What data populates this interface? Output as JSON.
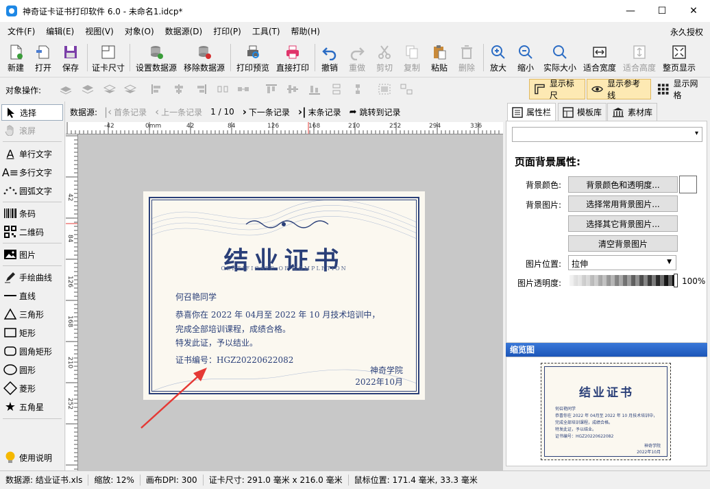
{
  "window": {
    "title": "神奇证卡证书打印软件 6.0 - 未命名1.idcp*"
  },
  "menu": {
    "items": [
      "文件(F)",
      "编辑(E)",
      "视图(V)",
      "对象(O)",
      "数据源(D)",
      "打印(P)",
      "工具(T)",
      "帮助(H)"
    ],
    "license": "永久授权"
  },
  "toolbar": {
    "new": "新建",
    "open": "打开",
    "save": "保存",
    "card_size": "证卡尺寸",
    "set_datasource": "设置数据源",
    "remove_datasource": "移除数据源",
    "print_preview": "打印预览",
    "direct_print": "直接打印",
    "undo": "撤销",
    "redo": "重做",
    "cut": "剪切",
    "copy": "复制",
    "paste": "粘贴",
    "delete": "删除",
    "zoom_in": "放大",
    "zoom_out": "缩小",
    "actual_size": "实际大小",
    "fit_width": "适合宽度",
    "fit_height": "适合高度",
    "fit_page": "整页显示"
  },
  "opsbar": {
    "label": "对象操作:",
    "show_ruler": "显示标尺",
    "show_guides": "显示参考线",
    "show_grid": "显示网格"
  },
  "tools": {
    "select": "选择",
    "scroll": "滚屏",
    "single_text": "单行文字",
    "multi_text": "多行文字",
    "arc_text": "圆弧文字",
    "barcode": "条码",
    "qrcode": "二维码",
    "image": "图片",
    "freehand": "手绘曲线",
    "line": "直线",
    "triangle": "三角形",
    "rect": "矩形",
    "round_rect": "圆角矩形",
    "ellipse": "圆形",
    "diamond": "菱形",
    "star": "五角星",
    "help": "使用说明"
  },
  "records": {
    "label": "数据源:",
    "first": "首条记录",
    "prev": "上一条记录",
    "position": "1 / 10",
    "next": "下一条记录",
    "last": "末条记录",
    "jump": "跳转到记录"
  },
  "ruler": {
    "h_ticks": [
      "-42",
      "0mm",
      "42",
      "84",
      "126",
      "168",
      "210",
      "252",
      "294",
      "336"
    ],
    "v_ticks": [
      "42",
      "84",
      "126",
      "168",
      "210",
      "252"
    ]
  },
  "certificate": {
    "title": "结业证书",
    "subtitle": "CERTIFICATE OF COMPLETION",
    "name": "何召艳同学",
    "line1": "恭喜你在 2022 年 04月至 2022 年 10 月技术培训中，",
    "line2": "完成全部培训课程，成绩合格。",
    "line3": "特发此证，予以结业。",
    "cert_no_label": "证书编号：",
    "cert_no": "HGZ20220622082",
    "issuer": "神奇学院",
    "date": "2022年10月"
  },
  "rightpanel": {
    "tabs": [
      "属性栏",
      "模板库",
      "素材库"
    ],
    "section_title": "页面背景属性:",
    "bg_color_label": "背景颜色:",
    "bg_color_button": "背景颜色和透明度...",
    "bg_image_label": "背景图片:",
    "choose_common_bg": "选择常用背景图片...",
    "choose_other_bg": "选择其它背景图片...",
    "clear_bg": "清空背景图片",
    "image_position_label": "图片位置:",
    "image_position_value": "拉伸",
    "image_opacity_label": "图片透明度:",
    "image_opacity_value": "100%",
    "thumbnail_title": "缩览图"
  },
  "status": {
    "datasource": "数据源: 结业证书.xls",
    "zoom": "缩放: 12%",
    "dpi": "画布DPI: 300",
    "card_size": "证卡尺寸: 291.0 毫米 x 216.0 毫米",
    "mouse_pos": "鼠标位置: 171.4 毫米, 33.3 毫米"
  },
  "colors": {
    "accent": "#2a3f78",
    "arrow": "#e53935",
    "thumb_header": "#1c56b8"
  }
}
